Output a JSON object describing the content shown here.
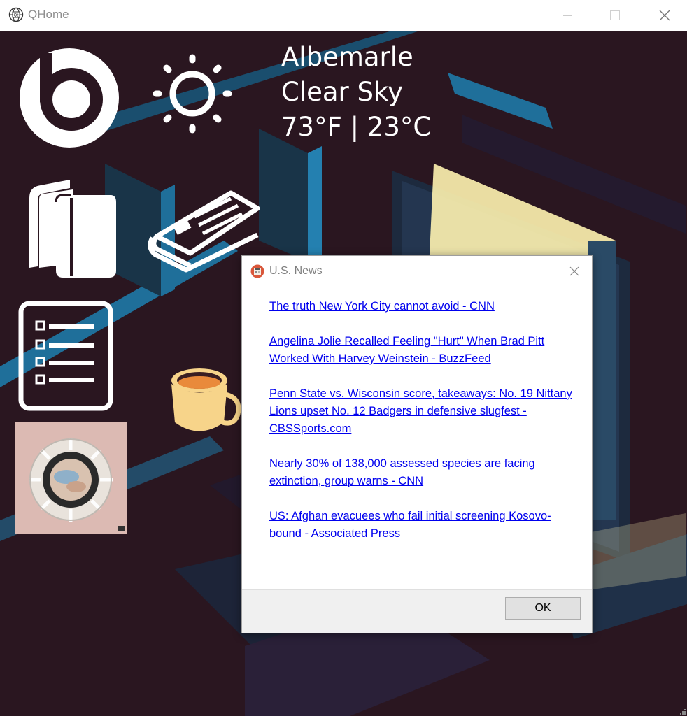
{
  "window": {
    "title": "QHome",
    "icon": "qt-globe-icon"
  },
  "weather": {
    "location": "Albemarle",
    "condition": "Clear Sky",
    "temperature": "73°F | 23°C",
    "icon": "sun-icon"
  },
  "tiles": {
    "music_icon": "beats-icon",
    "books_icon": "books-icon",
    "news_icon": "newspaper-icon",
    "todo_icon": "checklist-icon",
    "album_art": "album-cover-image"
  },
  "dialog": {
    "title": "U.S. News",
    "icon": "newspaper-app-icon",
    "articles": [
      "The truth New York City cannot avoid - CNN",
      "Angelina Jolie Recalled Feeling \"Hurt\" When Brad Pitt Worked With Harvey Weinstein - BuzzFeed",
      "Penn State vs. Wisconsin score, takeaways: No. 19 Nittany Lions upset No. 12 Badgers in defensive slugfest - CBSSports.com",
      "Nearly 30% of 138,000 assessed species are facing extinction, group warns - CNN",
      "US: Afghan evacuees who fail initial screening Kosovo-bound - Associated Press"
    ],
    "ok_label": "OK"
  },
  "colors": {
    "background": "#2a1620",
    "accent_blue": "#1f6f9a",
    "link": "#0000ee",
    "tile_white": "#ffffff"
  }
}
